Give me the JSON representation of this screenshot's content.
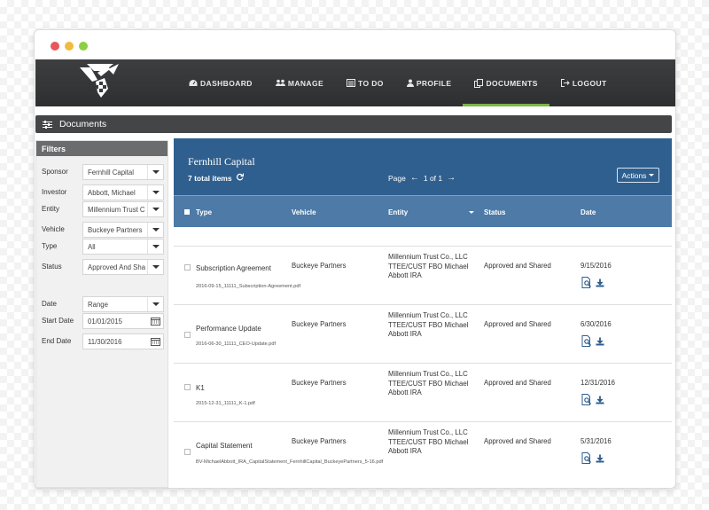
{
  "nav": {
    "items": [
      {
        "id": "dashboard",
        "label": "DASHBOARD",
        "icon": "dashboard-icon",
        "active": false
      },
      {
        "id": "manage",
        "label": "MANAGE",
        "icon": "users-icon",
        "active": false
      },
      {
        "id": "todo",
        "label": "TO DO",
        "icon": "list-icon",
        "active": false
      },
      {
        "id": "profile",
        "label": "PROFILE",
        "icon": "user-icon",
        "active": false
      },
      {
        "id": "documents",
        "label": "DOCUMENTS",
        "icon": "copy-icon",
        "active": true
      },
      {
        "id": "logout",
        "label": "LOGOUT",
        "icon": "logout-icon",
        "active": false
      }
    ],
    "active_color": "#7ab648"
  },
  "section_title": "Documents",
  "filters": {
    "title": "Filters",
    "fields": [
      {
        "label": "Sponsor",
        "value": "Fernhill Capital",
        "kind": "select"
      },
      {
        "label": "Investor",
        "value": "Abbott, Michael",
        "kind": "select"
      },
      {
        "label": "Entity",
        "value": "Millennium Trust C",
        "kind": "select"
      },
      {
        "label": "Vehicle",
        "value": "Buckeye Partners",
        "kind": "select"
      },
      {
        "label": "Type",
        "value": "All",
        "kind": "select"
      },
      {
        "label": "Status",
        "value": "Approved And Sha",
        "kind": "select"
      },
      {
        "label": "Date",
        "value": "Range",
        "kind": "select"
      },
      {
        "label": "Start Date",
        "value": "01/01/2015",
        "kind": "date"
      },
      {
        "label": "End Date",
        "value": "11/30/2016",
        "kind": "date"
      }
    ]
  },
  "list": {
    "sponsor_title": "Fernhill Capital",
    "total": "7 total items",
    "page_label": "Page",
    "page_of": "1 of 1",
    "actions_label": "Actions",
    "columns": [
      "Type",
      "Vehicle",
      "Entity",
      "Status",
      "Date"
    ],
    "rows": [
      {
        "type": "Subscription Agreement",
        "file": "2016-09-15_11111_Subscription-Agreement.pdf",
        "vehicle": "Buckeye Partners",
        "entity": [
          "Millennium Trust Co., LLC",
          "TTEE/CUST FBO Michael",
          "Abbott IRA"
        ],
        "status": "Approved and Shared",
        "date": "9/15/2016"
      },
      {
        "type": "Performance Update",
        "file": "2016-06-30_11111_CEO-Update.pdf",
        "vehicle": "Buckeye Partners",
        "entity": [
          "Millennium Trust Co., LLC",
          "TTEE/CUST FBO Michael",
          "Abbott IRA"
        ],
        "status": "Approved and Shared",
        "date": "6/30/2016"
      },
      {
        "type": "K1",
        "file": "2015-12-31_11111_K-1.pdf",
        "vehicle": "Buckeye Partners",
        "entity": [
          "Millennium Trust Co., LLC",
          "TTEE/CUST FBO Michael",
          "Abbott IRA"
        ],
        "status": "Approved and Shared",
        "date": "12/31/2016"
      },
      {
        "type": "Capital Statement",
        "file": "BV-MichaelAbbott_IRA_CapitalStatement_FernhillCapital_BuckeyePartners_5-16.pdf",
        "vehicle": "Buckeye Partners",
        "entity": [
          "Millennium Trust Co., LLC",
          "TTEE/CUST FBO Michael",
          "Abbott IRA"
        ],
        "status": "Approved and Shared",
        "date": "5/31/2016"
      }
    ]
  },
  "colors": {
    "header_blue": "#2f5f8f",
    "column_blue": "#4d7aa6",
    "nav_dark": "#353638",
    "icon_blue": "#2f5f8f"
  }
}
